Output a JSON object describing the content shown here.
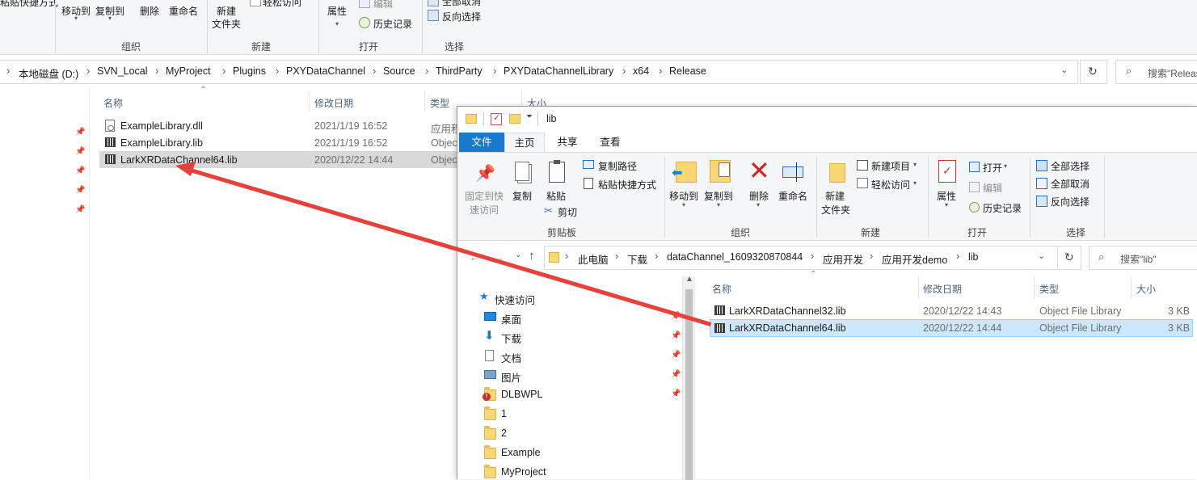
{
  "back_window": {
    "ribbon": {
      "paste_shortcut_partial": "粘贴快捷方式",
      "move_to": "移动到",
      "copy_to": "复制到",
      "delete": "删除",
      "rename": "重命名",
      "new_folder_line1": "新建",
      "new_folder_line2": "文件夹",
      "easy_access_partial": "轻松访问",
      "properties": "属性",
      "edit": "编辑",
      "history": "历史记录",
      "select_all_partial": "全部取消",
      "invert_selection": "反向选择",
      "group_organize": "组织",
      "group_new": "新建",
      "group_open": "打开",
      "group_select": "选择"
    },
    "breadcrumbs": [
      "本地磁盘 (D:)",
      "SVN_Local",
      "MyProject",
      "Plugins",
      "PXYDataChannel",
      "Source",
      "ThirdParty",
      "PXYDataChannelLibrary",
      "x64",
      "Release"
    ],
    "search_placeholder": "搜索\"Release\"",
    "columns": {
      "name": "名称",
      "modified": "修改日期",
      "type": "类型",
      "size": "大小"
    },
    "files": [
      {
        "name": "ExampleLibrary.dll",
        "modified": "2021/1/19 16:52",
        "type": "应用程序扩展",
        "icon": "dll-icon"
      },
      {
        "name": "ExampleLibrary.lib",
        "modified": "2021/1/19 16:52",
        "type": "Object File Library",
        "icon": "lib-icon"
      },
      {
        "name": "LarkXRDataChannel64.lib",
        "modified": "2020/12/22 14:44",
        "type": "Object File Library",
        "icon": "lib-icon",
        "selected": true
      }
    ]
  },
  "front_window": {
    "title": "lib",
    "tabs": {
      "file": "文件",
      "home": "主页",
      "share": "共享",
      "view": "查看"
    },
    "ribbon": {
      "pin_quick_access_1": "固定到快",
      "pin_quick_access_2": "速访问",
      "copy": "复制",
      "paste": "粘贴",
      "copy_path": "复制路径",
      "paste_shortcut": "粘贴快捷方式",
      "cut": "剪切",
      "group_clipboard": "剪贴板",
      "move_to": "移动到",
      "copy_to": "复制到",
      "delete": "删除",
      "rename": "重命名",
      "group_organize": "组织",
      "new_folder_1": "新建",
      "new_folder_2": "文件夹",
      "new_item": "新建项目",
      "easy_access": "轻松访问",
      "group_new": "新建",
      "properties": "属性",
      "open": "打开",
      "edit": "编辑",
      "history": "历史记录",
      "group_open": "打开",
      "select_all": "全部选择",
      "select_none": "全部取消",
      "invert_selection": "反向选择",
      "group_select": "选择"
    },
    "breadcrumbs": [
      "此电脑",
      "下载",
      "dataChannel_1609320870844",
      "应用开发",
      "应用开发demo",
      "lib"
    ],
    "search_placeholder": "搜索\"lib\"",
    "nav": [
      {
        "label": "快速访问",
        "icon": "star-icon"
      },
      {
        "label": "桌面",
        "icon": "desktop-icon",
        "pinned": true
      },
      {
        "label": "下载",
        "icon": "download-icon",
        "pinned": true
      },
      {
        "label": "文档",
        "icon": "document-icon",
        "pinned": true
      },
      {
        "label": "图片",
        "icon": "picture-icon",
        "pinned": true
      },
      {
        "label": "DLBWPL",
        "icon": "warning-folder-icon",
        "pinned": true
      },
      {
        "label": "1",
        "icon": "folder-icon"
      },
      {
        "label": "2",
        "icon": "folder-icon"
      },
      {
        "label": "Example",
        "icon": "folder-icon"
      },
      {
        "label": "MyProject",
        "icon": "folder-icon"
      }
    ],
    "columns": {
      "name": "名称",
      "modified": "修改日期",
      "type": "类型",
      "size": "大小"
    },
    "files": [
      {
        "name": "LarkXRDataChannel32.lib",
        "modified": "2020/12/22 14:43",
        "type": "Object File Library",
        "size": "3 KB"
      },
      {
        "name": "LarkXRDataChannel64.lib",
        "modified": "2020/12/22 14:44",
        "type": "Object File Library",
        "size": "3 KB",
        "selected": true
      }
    ]
  },
  "colors": {
    "accent": "#1979ca",
    "selection": "#cce8ff",
    "arrow": "#e8403a"
  }
}
